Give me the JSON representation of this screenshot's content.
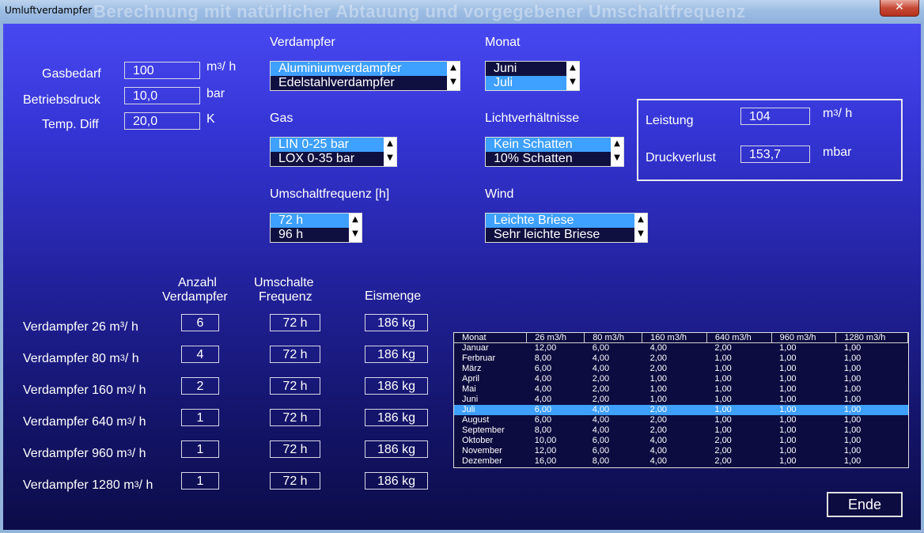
{
  "window": {
    "title": "Umluftverdampfer",
    "title_ghost": "Berechnung mit natürlicher Abtauung und vorgegebener Umschaltfrequenz",
    "close_label": "✕"
  },
  "inputs": {
    "gasbedarf": {
      "label": "Gasbedarf",
      "value": "100",
      "unit_main": "m",
      "unit_sup": "3",
      "unit_rest": "/ h"
    },
    "betriebsdruck": {
      "label": "Betriebsdruck",
      "value": "10,0",
      "unit": "bar"
    },
    "temp_diff": {
      "label": "Temp. Diff",
      "value": "20,0",
      "unit": "K"
    }
  },
  "lists": {
    "verdampfer": {
      "label": "Verdampfer",
      "items": [
        "Aluminiumverdampfer",
        "Edelstahlverdampfer"
      ],
      "selected": 0
    },
    "gas": {
      "label": "Gas",
      "items": [
        "LIN 0-25 bar",
        "LOX 0-35 bar"
      ],
      "selected": 0
    },
    "umschaltfrequenz": {
      "label": "Umschaltfrequenz [h]",
      "items": [
        "72 h",
        "96 h"
      ],
      "selected": 0
    },
    "monat": {
      "label": "Monat",
      "items": [
        "Juni",
        "Juli"
      ],
      "selected": 1
    },
    "licht": {
      "label": "Lichtverhältnisse",
      "items": [
        "Kein Schatten",
        "10% Schatten"
      ],
      "selected": 0
    },
    "wind": {
      "label": "Wind",
      "items": [
        "Leichte Briese",
        "Sehr leichte Briese"
      ],
      "selected": 0
    }
  },
  "result": {
    "leistung": {
      "label": "Leistung",
      "value": "104",
      "unit_main": "m",
      "unit_sup": "3",
      "unit_rest": "/ h"
    },
    "druckverlust": {
      "label": "Druckverlust",
      "value": "153,7",
      "unit": "mbar"
    }
  },
  "columns": {
    "anzahl_1": "Anzahl",
    "anzahl_2": "Verdampfer",
    "freq_1": "Umschalte",
    "freq_2": "Frequenz",
    "eis": "Eismenge"
  },
  "rows": [
    {
      "label": "Verdampfer  26 m³/ h",
      "label_pre": "",
      "label_sup": "",
      "label_post": "",
      "anzahl": "6",
      "freq": "72 h",
      "eis": "186 kg"
    },
    {
      "label": "",
      "label_pre": "Verdampfer  80 m",
      "label_sup": "3",
      "label_post": "/ h",
      "anzahl": "4",
      "freq": "72 h",
      "eis": "186 kg"
    },
    {
      "label": "",
      "label_pre": "Verdampfer  160 m",
      "label_sup": "3",
      "label_post": "/ h",
      "anzahl": "2",
      "freq": "72 h",
      "eis": "186 kg"
    },
    {
      "label": "",
      "label_pre": "Verdampfer  640 m",
      "label_sup": "3",
      "label_post": "/ h",
      "anzahl": "1",
      "freq": "72 h",
      "eis": "186 kg"
    },
    {
      "label": "",
      "label_pre": "Verdampfer  960 m",
      "label_sup": "3",
      "label_post": "/ h",
      "anzahl": "1",
      "freq": "72 h",
      "eis": "186 kg"
    },
    {
      "label": "",
      "label_pre": "Verdampfer  1280 m",
      "label_sup": "3",
      "label_post": "/ h",
      "anzahl": "1",
      "freq": "72 h",
      "eis": "186 kg"
    }
  ],
  "table": {
    "headers": [
      "Monat",
      "26 m3/h",
      "80 m3/h",
      "160 m3/h",
      "640 m3/h",
      "960 m3/h",
      "1280 m3/h"
    ],
    "selected_row": 6,
    "rows": [
      [
        "Januar",
        "12,00",
        "6,00",
        "4,00",
        "2,00",
        "1,00",
        "1,00"
      ],
      [
        "Ferbruar",
        "8,00",
        "4,00",
        "2,00",
        "1,00",
        "1,00",
        "1,00"
      ],
      [
        "März",
        "6,00",
        "4,00",
        "2,00",
        "1,00",
        "1,00",
        "1,00"
      ],
      [
        "April",
        "4,00",
        "2,00",
        "1,00",
        "1,00",
        "1,00",
        "1,00"
      ],
      [
        "Mai",
        "4,00",
        "2,00",
        "1,00",
        "1,00",
        "1,00",
        "1,00"
      ],
      [
        "Juni",
        "4,00",
        "2,00",
        "1,00",
        "1,00",
        "1,00",
        "1,00"
      ],
      [
        "Juli",
        "6,00",
        "4,00",
        "2,00",
        "1,00",
        "1,00",
        "1,00"
      ],
      [
        "August",
        "6,00",
        "4,00",
        "2,00",
        "1,00",
        "1,00",
        "1,00"
      ],
      [
        "September",
        "8,00",
        "4,00",
        "2,00",
        "1,00",
        "1,00",
        "1,00"
      ],
      [
        "Oktober",
        "10,00",
        "6,00",
        "4,00",
        "2,00",
        "1,00",
        "1,00"
      ],
      [
        "November",
        "12,00",
        "6,00",
        "4,00",
        "2,00",
        "1,00",
        "1,00"
      ],
      [
        "Dezember",
        "16,00",
        "8,00",
        "4,00",
        "2,00",
        "1,00",
        "1,00"
      ]
    ]
  },
  "buttons": {
    "ende": "Ende"
  },
  "colors": {
    "selection": "#3ea0ff",
    "background_top": "#4848f2",
    "background_bottom": "#0c0c48"
  },
  "icons": {
    "scroll_up": "▲",
    "scroll_down": "▼"
  }
}
